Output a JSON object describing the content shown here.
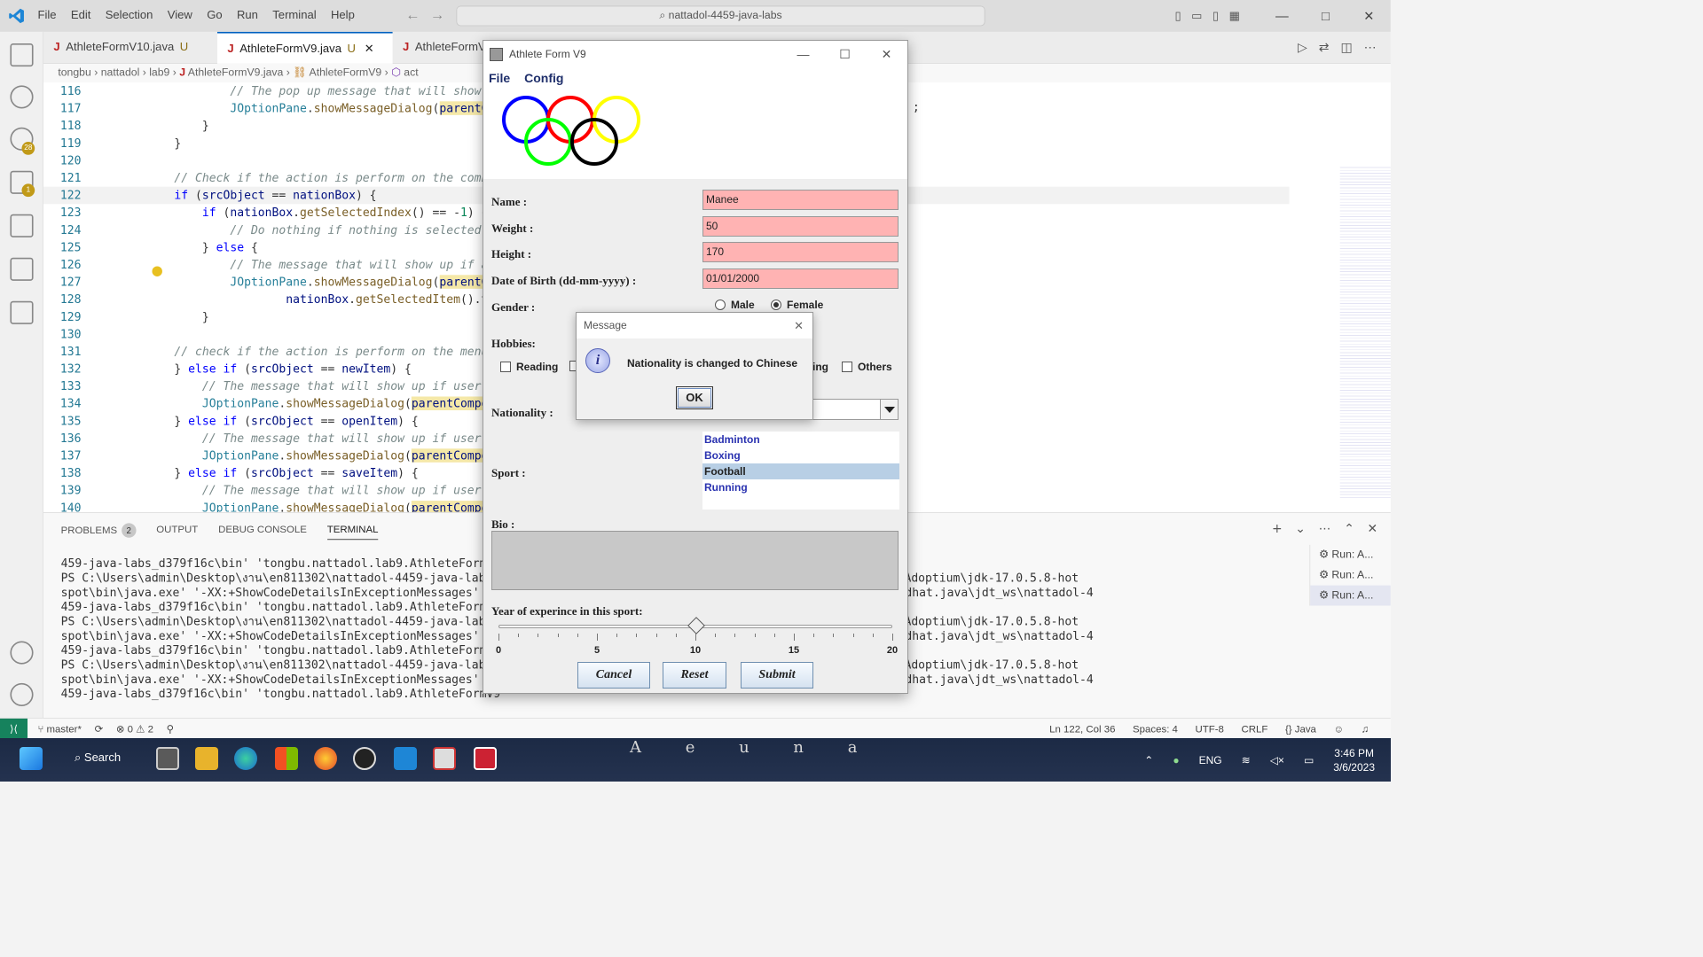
{
  "vscode": {
    "menu": [
      "File",
      "Edit",
      "Selection",
      "View",
      "Go",
      "Run",
      "Terminal",
      "Help"
    ],
    "search_box": "nattadol-4459-java-labs",
    "activity_badges": {
      "source_control": "28",
      "run_debug": "1"
    },
    "tabs": [
      {
        "name": "AthleteFormV10.java",
        "status": "U",
        "active": false
      },
      {
        "name": "AthleteFormV9.java",
        "status": "U",
        "active": true
      },
      {
        "name": "AthleteFormV",
        "status": "",
        "active": false
      }
    ],
    "breadcrumbs": [
      "tongbu",
      "nattadol",
      "lab9",
      "AthleteFormV9.java",
      "AthleteFormV9",
      "act"
    ],
    "code_lines": [
      {
        "num": "116",
        "html": "            <span class=\"c\">// The pop up message that will show u</span>"
      },
      {
        "num": "117",
        "html": "            <span class=\"t\">JOptionPane</span>.<span class=\"f\">showMessageDialog</span>(<span class=\"h v\">parentCo</span>"
      },
      {
        "num": "118",
        "html": "        }"
      },
      {
        "num": "119",
        "html": "    }"
      },
      {
        "num": "120",
        "html": ""
      },
      {
        "num": "121",
        "html": "    <span class=\"c\">// Check if the action is perform on the combo</span>"
      },
      {
        "num": "122",
        "html": "    <span class=\"k\">if</span> (<span class=\"v\">srcObject</span> == <span class=\"v\">nationBox</span>) {"
      },
      {
        "num": "123",
        "html": "        <span class=\"k\">if</span> (<span class=\"v\">nationBox</span>.<span class=\"f\">getSelectedIndex</span>() == -<span class=\"n\">1</span>) {"
      },
      {
        "num": "124",
        "html": "            <span class=\"c\">// Do nothing if nothing is selected i</span>"
      },
      {
        "num": "125",
        "html": "        } <span class=\"k\">else</span> {"
      },
      {
        "num": "126",
        "html": "            <span class=\"c\">// The message that will show up if an</span>"
      },
      {
        "num": "127",
        "html": "            <span class=\"t\">JOptionPane</span>.<span class=\"f\">showMessageDialog</span>(<span class=\"h v\">parentCo</span>"
      },
      {
        "num": "128",
        "html": "                    <span class=\"v\">nationBox</span>.<span class=\"f\">getSelectedItem</span>().to"
      },
      {
        "num": "129",
        "html": "        }"
      },
      {
        "num": "130",
        "html": ""
      },
      {
        "num": "131",
        "html": "    <span class=\"c\">// check if the action is perform on the menu</span>"
      },
      {
        "num": "132",
        "html": "    } <span class=\"k\">else if</span> (<span class=\"v\">srcObject</span> == <span class=\"v\">newItem</span>) {"
      },
      {
        "num": "133",
        "html": "        <span class=\"c\">// The message that will show up if user c</span>"
      },
      {
        "num": "134",
        "html": "        <span class=\"t\">JOptionPane</span>.<span class=\"f\">showMessageDialog</span>(<span class=\"h v\">parentCompon</span>"
      },
      {
        "num": "135",
        "html": "    } <span class=\"k\">else if</span> (<span class=\"v\">srcObject</span> == <span class=\"v\">openItem</span>) {"
      },
      {
        "num": "136",
        "html": "        <span class=\"c\">// The message that will show up if user c</span>"
      },
      {
        "num": "137",
        "html": "        <span class=\"t\">JOptionPane</span>.<span class=\"f\">showMessageDialog</span>(<span class=\"h v\">parentCompon</span>"
      },
      {
        "num": "138",
        "html": "    } <span class=\"k\">else if</span> (<span class=\"v\">srcObject</span> == <span class=\"v\">saveItem</span>) {"
      },
      {
        "num": "139",
        "html": "        <span class=\"c\">// The message that will show up if user c</span>"
      },
      {
        "num": "140",
        "html": "        <span class=\"t\">JOptionPane</span>.<span class=\"f\">showMessageDialog</span>(<span class=\"h v\">parentCompon</span>"
      }
    ],
    "line_117_tail": ";",
    "current_line": "122",
    "panel_tabs": [
      "PROBLEMS",
      "OUTPUT",
      "DEBUG CONSOLE",
      "TERMINAL"
    ],
    "problems_count": "2",
    "terminal_lines": [
      "459-java-labs_d379f16c\\bin' 'tongbu.nattadol.lab9.AthleteFormV9'",
      "PS C:\\Users\\admin\\Desktop\\งาน\\en811302\\nattadol-4459-java-labs>                         bs'; & 'C:\\Program Files\\Eclipse Adoptium\\jdk-17.0.5.8-hot",
      "spot\\bin\\java.exe' '-XX:+ShowCodeDetailsInExceptionMessages' '-cp                         01a2c8de3fa55201d5a852a7cd86\\redhat.java\\jdt_ws\\nattadol-4",
      "459-java-labs_d379f16c\\bin' 'tongbu.nattadol.lab9.AthleteFormV9'",
      "PS C:\\Users\\admin\\Desktop\\งาน\\en811302\\nattadol-4459-java-labs>                         bs'; & 'C:\\Program Files\\Eclipse Adoptium\\jdk-17.0.5.8-hot",
      "spot\\bin\\java.exe' '-XX:+ShowCodeDetailsInExceptionMessages' '-cp                         01a2c8de3fa55201d5a852a7cd86\\redhat.java\\jdt_ws\\nattadol-4",
      "459-java-labs_d379f16c\\bin' 'tongbu.nattadol.lab9.AthleteFormV9'",
      "PS C:\\Users\\admin\\Desktop\\งาน\\en811302\\nattadol-4459-java-labs>                         bs'; & 'C:\\Program Files\\Eclipse Adoptium\\jdk-17.0.5.8-hot",
      "spot\\bin\\java.exe' '-XX:+ShowCodeDetailsInExceptionMessages' '-cp                         01a2c8de3fa55201d5a852a7cd86\\redhat.java\\jdt_ws\\nattadol-4",
      "459-java-labs_d379f16c\\bin' 'tongbu.nattadol.lab9.AthleteFormV9'"
    ],
    "run_items": [
      "Run: A...",
      "Run: A...",
      "Run: A..."
    ],
    "status": {
      "branch": "master*",
      "errors": "0",
      "warnings": "2",
      "position": "Ln 122, Col 36",
      "spaces": "Spaces: 4",
      "encoding": "UTF-8",
      "eol": "CRLF",
      "language": "{} Java"
    }
  },
  "athlete_form": {
    "title": "Athlete Form V9",
    "menu": [
      "File",
      "Config"
    ],
    "labels": {
      "name": "Name :",
      "weight": "Weight :",
      "height": "Height :",
      "dob": "Date of Birth (dd-mm-yyyy) :",
      "gender": "Gender :",
      "hobbies": "Hobbies:",
      "nationality": "Nationality :",
      "sport": "Sport :",
      "bio": "Bio :",
      "experience": "Year of experince in this sport:"
    },
    "values": {
      "name": "Manee",
      "weight": "50",
      "height": "170",
      "dob": "01/01/2000"
    },
    "gender_options": [
      {
        "label": "Male",
        "selected": false
      },
      {
        "label": "Female",
        "selected": true
      }
    ],
    "hobbies": [
      {
        "label": "Reading",
        "checked": false
      },
      {
        "label": "ing",
        "checked": false
      },
      {
        "label": "Others",
        "checked": false
      }
    ],
    "sports": [
      {
        "label": "Badminton",
        "selected": false
      },
      {
        "label": "Boxing",
        "selected": false
      },
      {
        "label": "Football",
        "selected": true
      },
      {
        "label": "Running",
        "selected": false
      }
    ],
    "experience": {
      "value": 10,
      "min": 0,
      "max": 20,
      "major_labels": [
        "0",
        "5",
        "10",
        "15",
        "20"
      ]
    },
    "buttons": {
      "cancel": "Cancel",
      "reset": "Reset",
      "submit": "Submit"
    },
    "ring_colors": [
      "#0000ff",
      "#ff0000",
      "#ffff00",
      "#00ff00",
      "#000000"
    ]
  },
  "message_dialog": {
    "title": "Message",
    "text": "Nationality is changed to Chinese",
    "ok": "OK"
  },
  "taskbar": {
    "search": "Search",
    "wallpaper_text": "A e u n a",
    "lang": "ENG",
    "time": "3:46 PM",
    "date": "3/6/2023"
  }
}
